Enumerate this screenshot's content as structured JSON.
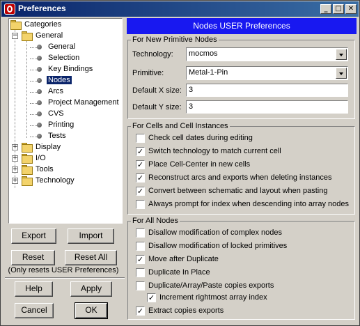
{
  "window": {
    "title": "Preferences",
    "controls": {
      "minimize": "_",
      "maximize": "□",
      "close": "✕"
    }
  },
  "tree": {
    "root": "Categories",
    "general": "General",
    "general_items": [
      "General",
      "Selection",
      "Key Bindings",
      "Nodes",
      "Arcs",
      "Project Management",
      "CVS",
      "Printing",
      "Tests"
    ],
    "selected": "Nodes",
    "collapsed": [
      "Display",
      "I/O",
      "Tools",
      "Technology"
    ]
  },
  "left_buttons": {
    "export": "Export",
    "import": "Import",
    "reset": "Reset",
    "reset_all": "Reset All",
    "reset_note": "(Only resets USER Preferences)",
    "help": "Help",
    "apply": "Apply",
    "cancel": "Cancel",
    "ok": "OK"
  },
  "panel": {
    "header": "Nodes USER Preferences",
    "new_primitive": {
      "title": "For New Primitive Nodes",
      "technology_label": "Technology:",
      "technology_value": "mocmos",
      "primitive_label": "Primitive:",
      "primitive_value": "Metal-1-Pin",
      "xsize_label": "Default X size:",
      "xsize_value": "3",
      "ysize_label": "Default Y size:",
      "ysize_value": "3"
    },
    "cells": {
      "title": "For Cells and Cell Instances",
      "options": [
        {
          "label": "Check cell dates during editing",
          "checked": false
        },
        {
          "label": "Switch technology to match current cell",
          "checked": true
        },
        {
          "label": "Place Cell-Center in new cells",
          "checked": true
        },
        {
          "label": "Reconstruct arcs and exports when deleting instances",
          "checked": true
        },
        {
          "label": "Convert between schematic and layout when pasting",
          "checked": true
        },
        {
          "label": "Always prompt for index when descending into array nodes",
          "checked": false
        }
      ]
    },
    "all_nodes": {
      "title": "For All Nodes",
      "options": [
        {
          "label": "Disallow modification of complex nodes",
          "checked": false
        },
        {
          "label": "Disallow modification of locked primitives",
          "checked": false
        },
        {
          "label": "Move after Duplicate",
          "checked": true
        },
        {
          "label": "Duplicate In Place",
          "checked": false
        },
        {
          "label": "Duplicate/Array/Paste copies exports",
          "checked": false
        },
        {
          "label": "Increment rightmost array index",
          "checked": true
        },
        {
          "label": "Extract copies exports",
          "checked": true
        }
      ]
    }
  }
}
